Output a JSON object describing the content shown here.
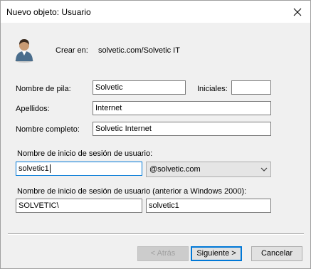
{
  "window": {
    "title": "Nuevo objeto: Usuario"
  },
  "header": {
    "create_in_label": "Crear en:",
    "create_in_value": "solvetic.com/Solvetic IT"
  },
  "form": {
    "first_name_label": "Nombre de pila:",
    "first_name_value": "Solvetic",
    "initials_label": "Iniciales:",
    "initials_value": "",
    "last_name_label": "Apellidos:",
    "last_name_value": "Internet",
    "full_name_label": "Nombre completo:",
    "full_name_value": "Solvetic Internet",
    "logon_label": "Nombre de inicio de sesión de usuario:",
    "logon_value": "solvetic1",
    "domain_value": "@solvetic.com",
    "legacy_logon_label": "Nombre de inicio de sesión de usuario (anterior a Windows 2000):",
    "legacy_domain_value": "SOLVETIC\\",
    "legacy_logon_value": "solvetic1"
  },
  "buttons": {
    "back": "< Atrás",
    "next": "Siguiente >",
    "cancel": "Cancelar"
  },
  "icons": {
    "close": "close-icon",
    "user": "user-icon",
    "dropdown": "chevron-down-icon"
  },
  "colors": {
    "focus": "#0078d7",
    "disabled_text": "#a0a0a0"
  }
}
